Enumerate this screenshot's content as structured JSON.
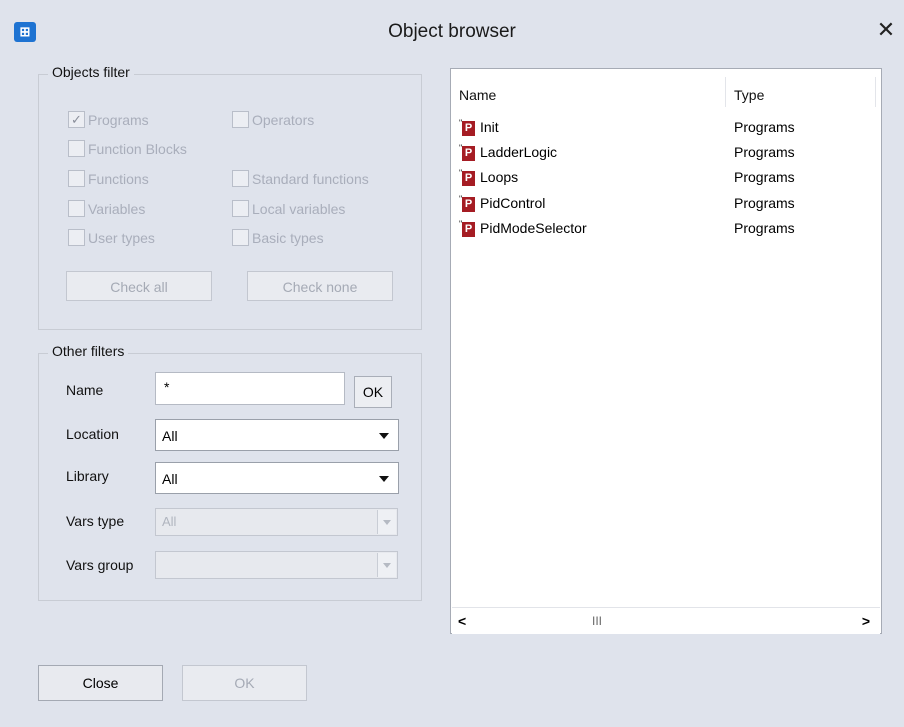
{
  "window": {
    "title": "Object browser",
    "icon": "app-logo-icon",
    "close_glyph": "✕"
  },
  "objects_filter": {
    "legend": "Objects filter",
    "checkboxes": {
      "programs": {
        "label": "Programs",
        "checked": true
      },
      "operators": {
        "label": "Operators",
        "checked": false
      },
      "function_blocks": {
        "label": "Function Blocks",
        "checked": false
      },
      "functions": {
        "label": "Functions",
        "checked": false
      },
      "standard_functions": {
        "label": "Standard functions",
        "checked": false
      },
      "variables": {
        "label": "Variables",
        "checked": false
      },
      "local_variables": {
        "label": "Local variables",
        "checked": false
      },
      "user_types": {
        "label": "User types",
        "checked": false
      },
      "basic_types": {
        "label": "Basic types",
        "checked": false
      }
    },
    "check_all": "Check all",
    "check_none": "Check none"
  },
  "other_filters": {
    "legend": "Other filters",
    "name_label": "Name",
    "name_value": "*",
    "ok_label": "OK",
    "location_label": "Location",
    "location_value": "All",
    "library_label": "Library",
    "library_value": "All",
    "vars_type_label": "Vars type",
    "vars_type_value": "All",
    "vars_group_label": "Vars group",
    "vars_group_value": ""
  },
  "results": {
    "columns": [
      "Name",
      "Type"
    ],
    "rows": [
      {
        "name": "Init",
        "type": "Programs",
        "icon": "program-icon"
      },
      {
        "name": "LadderLogic",
        "type": "Programs",
        "icon": "program-icon"
      },
      {
        "name": "Loops",
        "type": "Programs",
        "icon": "program-icon"
      },
      {
        "name": "PidControl",
        "type": "Programs",
        "icon": "program-icon"
      },
      {
        "name": "PidModeSelector",
        "type": "Programs",
        "icon": "program-icon"
      }
    ],
    "scroll": {
      "left": "<",
      "right": ">",
      "thumb": "III"
    }
  },
  "footer": {
    "close": "Close",
    "ok": "OK"
  }
}
